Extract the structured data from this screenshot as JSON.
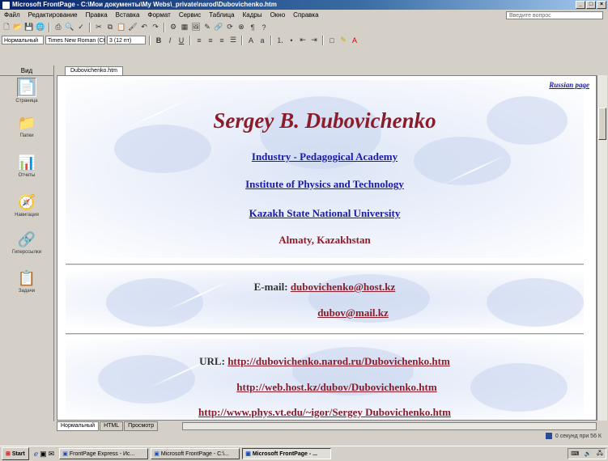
{
  "window": {
    "title": "Microsoft FrontPage - C:\\Мои документы\\My Webs\\_private\\narod\\Dubovichenko.htm"
  },
  "menu": [
    "Файл",
    "Редактирование",
    "Правка",
    "Вставка",
    "Формат",
    "Сервис",
    "Таблица",
    "Кадры",
    "Окно",
    "Справка"
  ],
  "help_box": "Введите вопрос",
  "toolbar2": {
    "style": "Нормальный",
    "font": "Times New Roman (Ct",
    "size": "3 (12 пт)"
  },
  "views": {
    "header": "Вид",
    "items": [
      {
        "label": "Страница",
        "icon": "page-view-icon"
      },
      {
        "label": "Папки",
        "icon": "folder-icon"
      },
      {
        "label": "Отчеты",
        "icon": "reports-icon"
      },
      {
        "label": "Навигация",
        "icon": "navigation-icon"
      },
      {
        "label": "Гиперссылки",
        "icon": "hyperlinks-icon"
      },
      {
        "label": "Задачи",
        "icon": "tasks-icon"
      }
    ]
  },
  "doc_tab": "Dubovichenko.htm",
  "page": {
    "russian_link": "Russian page",
    "name": "Sergey B. Dubovichenko",
    "affiliations": [
      "Industry - Pedagogical Academy",
      "Institute of Physics and Technology",
      "Kazakh State National University"
    ],
    "location": "Almaty, Kazakhstan",
    "email_label": "E-mail:",
    "emails": [
      "dubovichenko@host.kz",
      "dubov@mail.kz"
    ],
    "url_label": "URL:",
    "urls": [
      "http://dubovichenko.narod.ru/Dubovichenko.htm",
      "http://web.host.kz/dubov/Dubovichenko.htm",
      "http://www.phys.vt.edu/~igor/Sergey Dubovichenko.htm"
    ]
  },
  "view_tabs": [
    "Нормальный",
    "HTML",
    "Просмотр"
  ],
  "status": {
    "text": "0 секунд при 56 К"
  },
  "taskbar": {
    "start": "Start",
    "tasks": [
      {
        "label": "FrontPage Express - Ис...",
        "active": false
      },
      {
        "label": "Microsoft FrontPage - C:\\...",
        "active": false
      },
      {
        "label": "Microsoft FrontPage - ...",
        "active": true
      }
    ]
  }
}
